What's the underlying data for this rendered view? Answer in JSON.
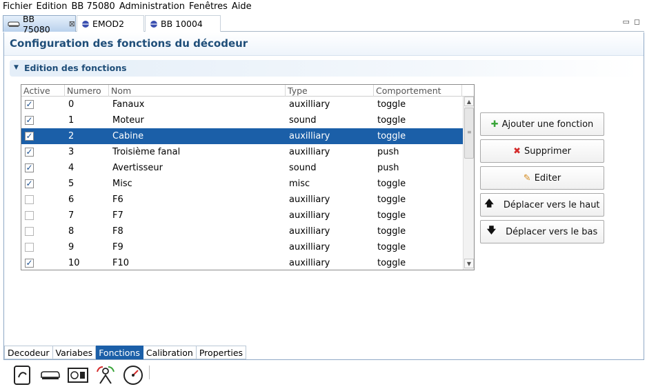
{
  "menu": [
    "Fichier",
    "Edition",
    "BB 75080",
    "Administration",
    "Fenêtres",
    "Aide"
  ],
  "editor_tabs": [
    {
      "label": "BB 75080",
      "icon": "locomotive-icon",
      "active": true,
      "closable": true
    },
    {
      "label": "EMOD2",
      "icon": "decoder-icon",
      "active": false
    },
    {
      "label": "BB 10004",
      "icon": "decoder-icon",
      "active": false
    }
  ],
  "window_controls": {
    "minimize": "▭",
    "maximize": "◻"
  },
  "page": {
    "title": "Configuration des fonctions du décodeur"
  },
  "section": {
    "title": "Edition des fonctions",
    "expanded": true
  },
  "table": {
    "columns": [
      "Active",
      "Numero",
      "Nom",
      "Type",
      "Comportement"
    ],
    "rows": [
      {
        "active": true,
        "numero": "0",
        "nom": "Fanaux",
        "type": "auxilliary",
        "comportement": "toggle",
        "selected": false
      },
      {
        "active": true,
        "numero": "1",
        "nom": "Moteur",
        "type": "sound",
        "comportement": "toggle",
        "selected": false
      },
      {
        "active": true,
        "numero": "2",
        "nom": "Cabine",
        "type": "auxilliary",
        "comportement": "toggle",
        "selected": true
      },
      {
        "active": true,
        "numero": "3",
        "nom": "Troisième fanal",
        "type": "auxilliary",
        "comportement": "push",
        "selected": false
      },
      {
        "active": true,
        "numero": "4",
        "nom": "Avertisseur",
        "type": "sound",
        "comportement": "push",
        "selected": false
      },
      {
        "active": true,
        "numero": "5",
        "nom": "Misc",
        "type": "misc",
        "comportement": "toggle",
        "selected": false
      },
      {
        "active": false,
        "numero": "6",
        "nom": "F6",
        "type": "auxilliary",
        "comportement": "toggle",
        "selected": false
      },
      {
        "active": false,
        "numero": "7",
        "nom": "F7",
        "type": "auxilliary",
        "comportement": "toggle",
        "selected": false
      },
      {
        "active": false,
        "numero": "8",
        "nom": "F8",
        "type": "auxilliary",
        "comportement": "toggle",
        "selected": false
      },
      {
        "active": false,
        "numero": "9",
        "nom": "F9",
        "type": "auxilliary",
        "comportement": "toggle",
        "selected": false
      },
      {
        "active": true,
        "numero": "10",
        "nom": "F10",
        "type": "auxilliary",
        "comportement": "toggle",
        "selected": false
      }
    ]
  },
  "buttons": {
    "add": {
      "label": "Ajouter une fonction",
      "icon": "plus-icon",
      "color": "#3aa53a"
    },
    "delete": {
      "label": "Supprimer",
      "icon": "delete-icon",
      "color": "#d42b2b"
    },
    "edit": {
      "label": "Editer",
      "icon": "edit-icon",
      "color": "#d48a1e"
    },
    "up": {
      "label": "Déplacer vers le haut",
      "icon": "arrow-up-icon"
    },
    "down": {
      "label": "Déplacer vers le bas",
      "icon": "arrow-down-icon"
    }
  },
  "bottom_tabs": [
    {
      "label": "Decodeur",
      "active": false
    },
    {
      "label": "Variabes",
      "active": false
    },
    {
      "label": "Fonctions",
      "active": true
    },
    {
      "label": "Calibration",
      "active": false
    },
    {
      "label": "Properties",
      "active": false
    }
  ],
  "toolbar_icons": [
    "throttle-hand-icon",
    "locomotive-icon",
    "decoder-programmer-icon",
    "turntable-icon",
    "speedometer-icon"
  ],
  "colors": {
    "accent": "#1b5fa8",
    "title": "#1f4e79",
    "selection": "#1b5fa8"
  }
}
